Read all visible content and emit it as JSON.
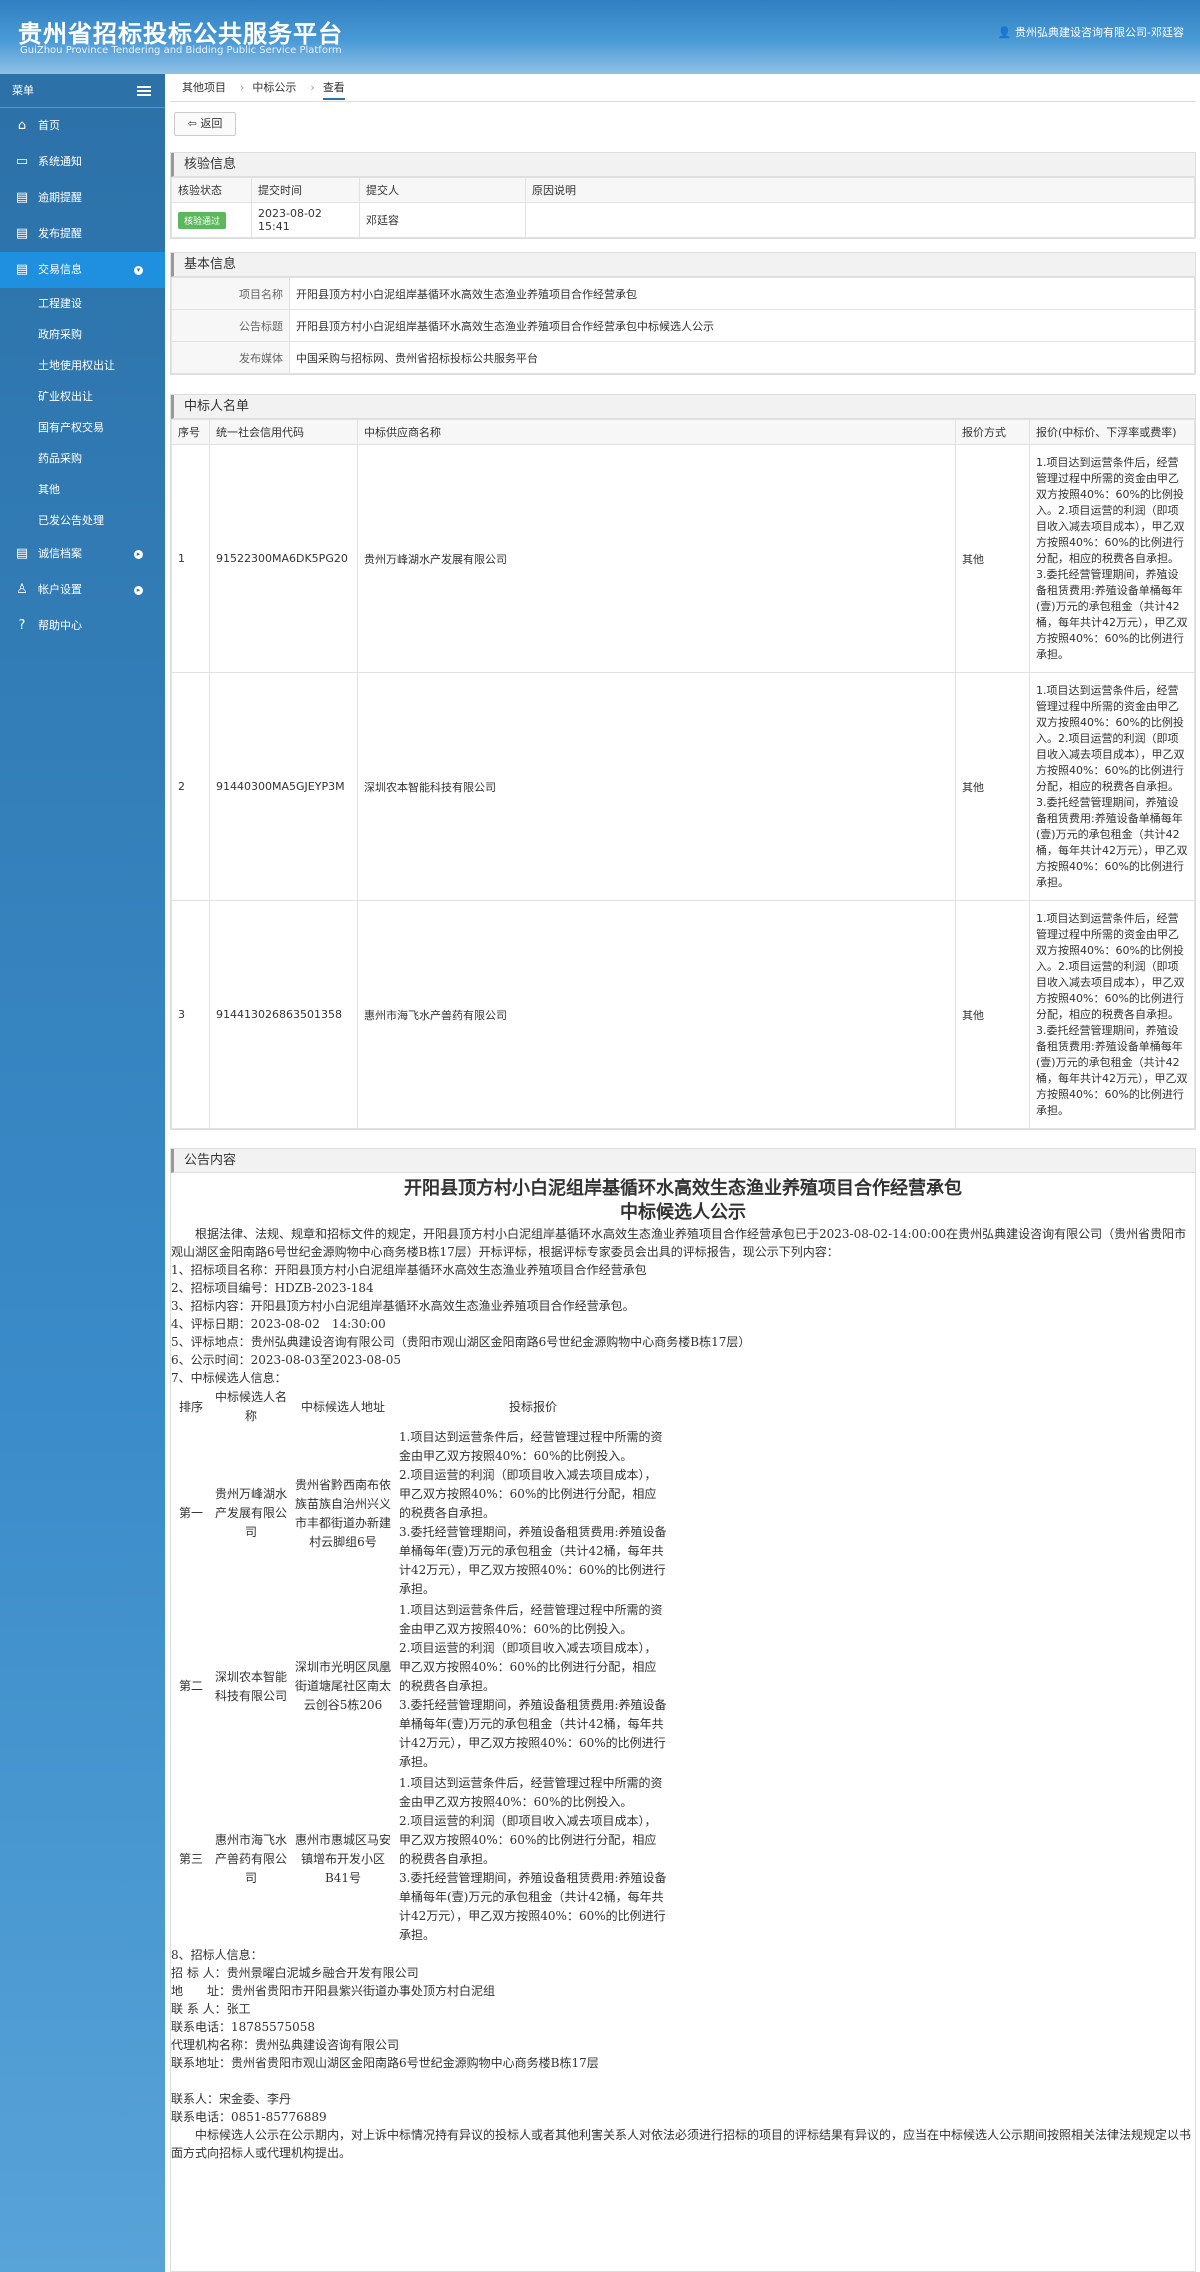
{
  "header": {
    "title": "贵州省招标投标公共服务平台",
    "subtitle": "GuiZhou Province Tendering and Bidding Public Service Platform",
    "user": "贵州弘典建设咨询有限公司-邓廷容"
  },
  "sidebar": {
    "head": "菜单",
    "items": [
      {
        "label": "首页",
        "icon": "⌂"
      },
      {
        "label": "系统通知",
        "icon": "▭"
      },
      {
        "label": "逾期提醒",
        "icon": "▤"
      },
      {
        "label": "发布提醒",
        "icon": "▤"
      },
      {
        "label": "交易信息",
        "icon": "▤"
      },
      {
        "label": "诚信档案",
        "icon": "▤"
      },
      {
        "label": "帐户设置",
        "icon": "♙"
      },
      {
        "label": "帮助中心",
        "icon": "?"
      }
    ],
    "subitems": [
      "工程建设",
      "政府采购",
      "土地使用权出让",
      "矿业权出让",
      "国有产权交易",
      "药品采购",
      "其他",
      "已发公告处理"
    ]
  },
  "breadcrumb": [
    "其他项目",
    "中标公示",
    "查看"
  ],
  "back_label": "返回",
  "audit": {
    "title": "核验信息",
    "headers": [
      "核验状态",
      "提交时间",
      "提交人",
      "原因说明"
    ],
    "status": "核验通过",
    "time": "2023-08-02 15:41",
    "person": "邓廷容",
    "reason": ""
  },
  "basic": {
    "title": "基本信息",
    "rows": [
      {
        "label": "项目名称",
        "value": "开阳县顶方村小白泥组岸基循环水高效生态渔业养殖项目合作经营承包"
      },
      {
        "label": "公告标题",
        "value": "开阳县顶方村小白泥组岸基循环水高效生态渔业养殖项目合作经营承包中标候选人公示"
      },
      {
        "label": "发布媒体",
        "value": "中国采购与招标网、贵州省招标投标公共服务平台"
      }
    ]
  },
  "winners": {
    "title": "中标人名单",
    "headers": [
      "序号",
      "统一社会信用代码",
      "中标供应商名称",
      "报价方式",
      "报价(中标价、下浮率或费率)"
    ],
    "rows": [
      {
        "no": "1",
        "code": "91522300MA6DK5PG20",
        "name": "贵州万峰湖水产发展有限公司",
        "mode": "其他"
      },
      {
        "no": "2",
        "code": "91440300MA5GJEYP3M",
        "name": "深圳农本智能科技有限公司",
        "mode": "其他"
      },
      {
        "no": "3",
        "code": "914413026863501358",
        "name": "惠州市海飞水产兽药有限公司",
        "mode": "其他"
      }
    ],
    "remark": "1.项目达到运营条件后，经营管理过程中所需的资金由甲乙双方按照40%：60%的比例投入。2.项目运营的利润（即项目收入减去项目成本），甲乙双方按照40%：60%的比例进行分配，相应的税费各自承担。3.委托经营管理期间，养殖设备租赁费用:养殖设备单桶每年(壹)万元的承包租金（共计42桶，每年共计42万元），甲乙双方按照40%：60%的比例进行承担。"
  },
  "notice": {
    "title": "公告内容",
    "heading1": "开阳县顶方村小白泥组岸基循环水高效生态渔业养殖项目合作经营承包",
    "heading2": "中标候选人公示",
    "intro": "根据法律、法规、规章和招标文件的规定，开阳县顶方村小白泥组岸基循环水高效生态渔业养殖项目合作经营承包已于2023-08-02-14:00:00在贵州弘典建设咨询有限公司（贵州省贵阳市观山湖区金阳南路6号世纪金源购物中心商务楼B栋17层）开标评标，根据评标专家委员会出具的评标报告，现公示下列内容：",
    "items": [
      "1、招标项目名称：开阳县顶方村小白泥组岸基循环水高效生态渔业养殖项目合作经营承包",
      "2、招标项目编号：HDZB-2023-184",
      "3、招标内容：开阳县顶方村小白泥组岸基循环水高效生态渔业养殖项目合作经营承包。",
      "4、评标日期：2023-08-02　14:30:00",
      "5、评标地点：贵州弘典建设咨询有限公司（贵阳市观山湖区金阳南路6号世纪金源购物中心商务楼B栋17层）",
      "6、公示时间：2023-08-03至2023-08-05",
      "7、中标候选人信息："
    ],
    "table_headers": [
      "排序",
      "中标候选人名称",
      "中标候选人地址",
      "投标报价"
    ],
    "candidates": [
      {
        "rank": "第一",
        "name": "贵州万峰湖水产发展有限公司",
        "addr": "贵州省黔西南布依族苗族自治州兴义市丰都街道办新建村云脚组6号"
      },
      {
        "rank": "第二",
        "name": "深圳农本智能科技有限公司",
        "addr": "深圳市光明区凤凰街道塘尾社区南太云创谷5栋206"
      },
      {
        "rank": "第三",
        "name": "惠州市海飞水产兽药有限公司",
        "addr": "惠州市惠城区马安镇增布开发小区B41号"
      }
    ],
    "quote": [
      "1.项目达到运营条件后，经营管理过程中所需的资金由甲乙双方按照40%：60%的比例投入。",
      "2.项目运营的利润（即项目收入减去项目成本），甲乙双方按照40%：60%的比例进行分配，相应的税费各自承担。",
      "3.委托经营管理期间，养殖设备租赁费用:养殖设备单桶每年(壹)万元的承包租金（共计42桶，每年共计42万元），甲乙双方按照40%：60%的比例进行承担。"
    ],
    "contacts": [
      "8、招标人信息：",
      "招 标 人：贵州景曜白泥城乡融合开发有限公司",
      "地　　址：贵州省贵阳市开阳县紫兴街道办事处顶方村白泥组",
      "联 系 人：张工",
      "联系电话：18785575058",
      "代理机构名称：贵州弘典建设咨询有限公司",
      "联系地址：贵州省贵阳市观山湖区金阳南路6号世纪金源购物中心商务楼B栋17层",
      "",
      "联系人：宋金委、李丹",
      "联系电话：0851-85776889"
    ],
    "footer": "中标候选人公示在公示期内，对上诉中标情况持有异议的投标人或者其他利害关系人对依法必须进行招标的项目的评标结果有异议的，应当在中标候选人公示期间按照相关法律法规规定以书面方式向招标人或代理机构提出。"
  }
}
